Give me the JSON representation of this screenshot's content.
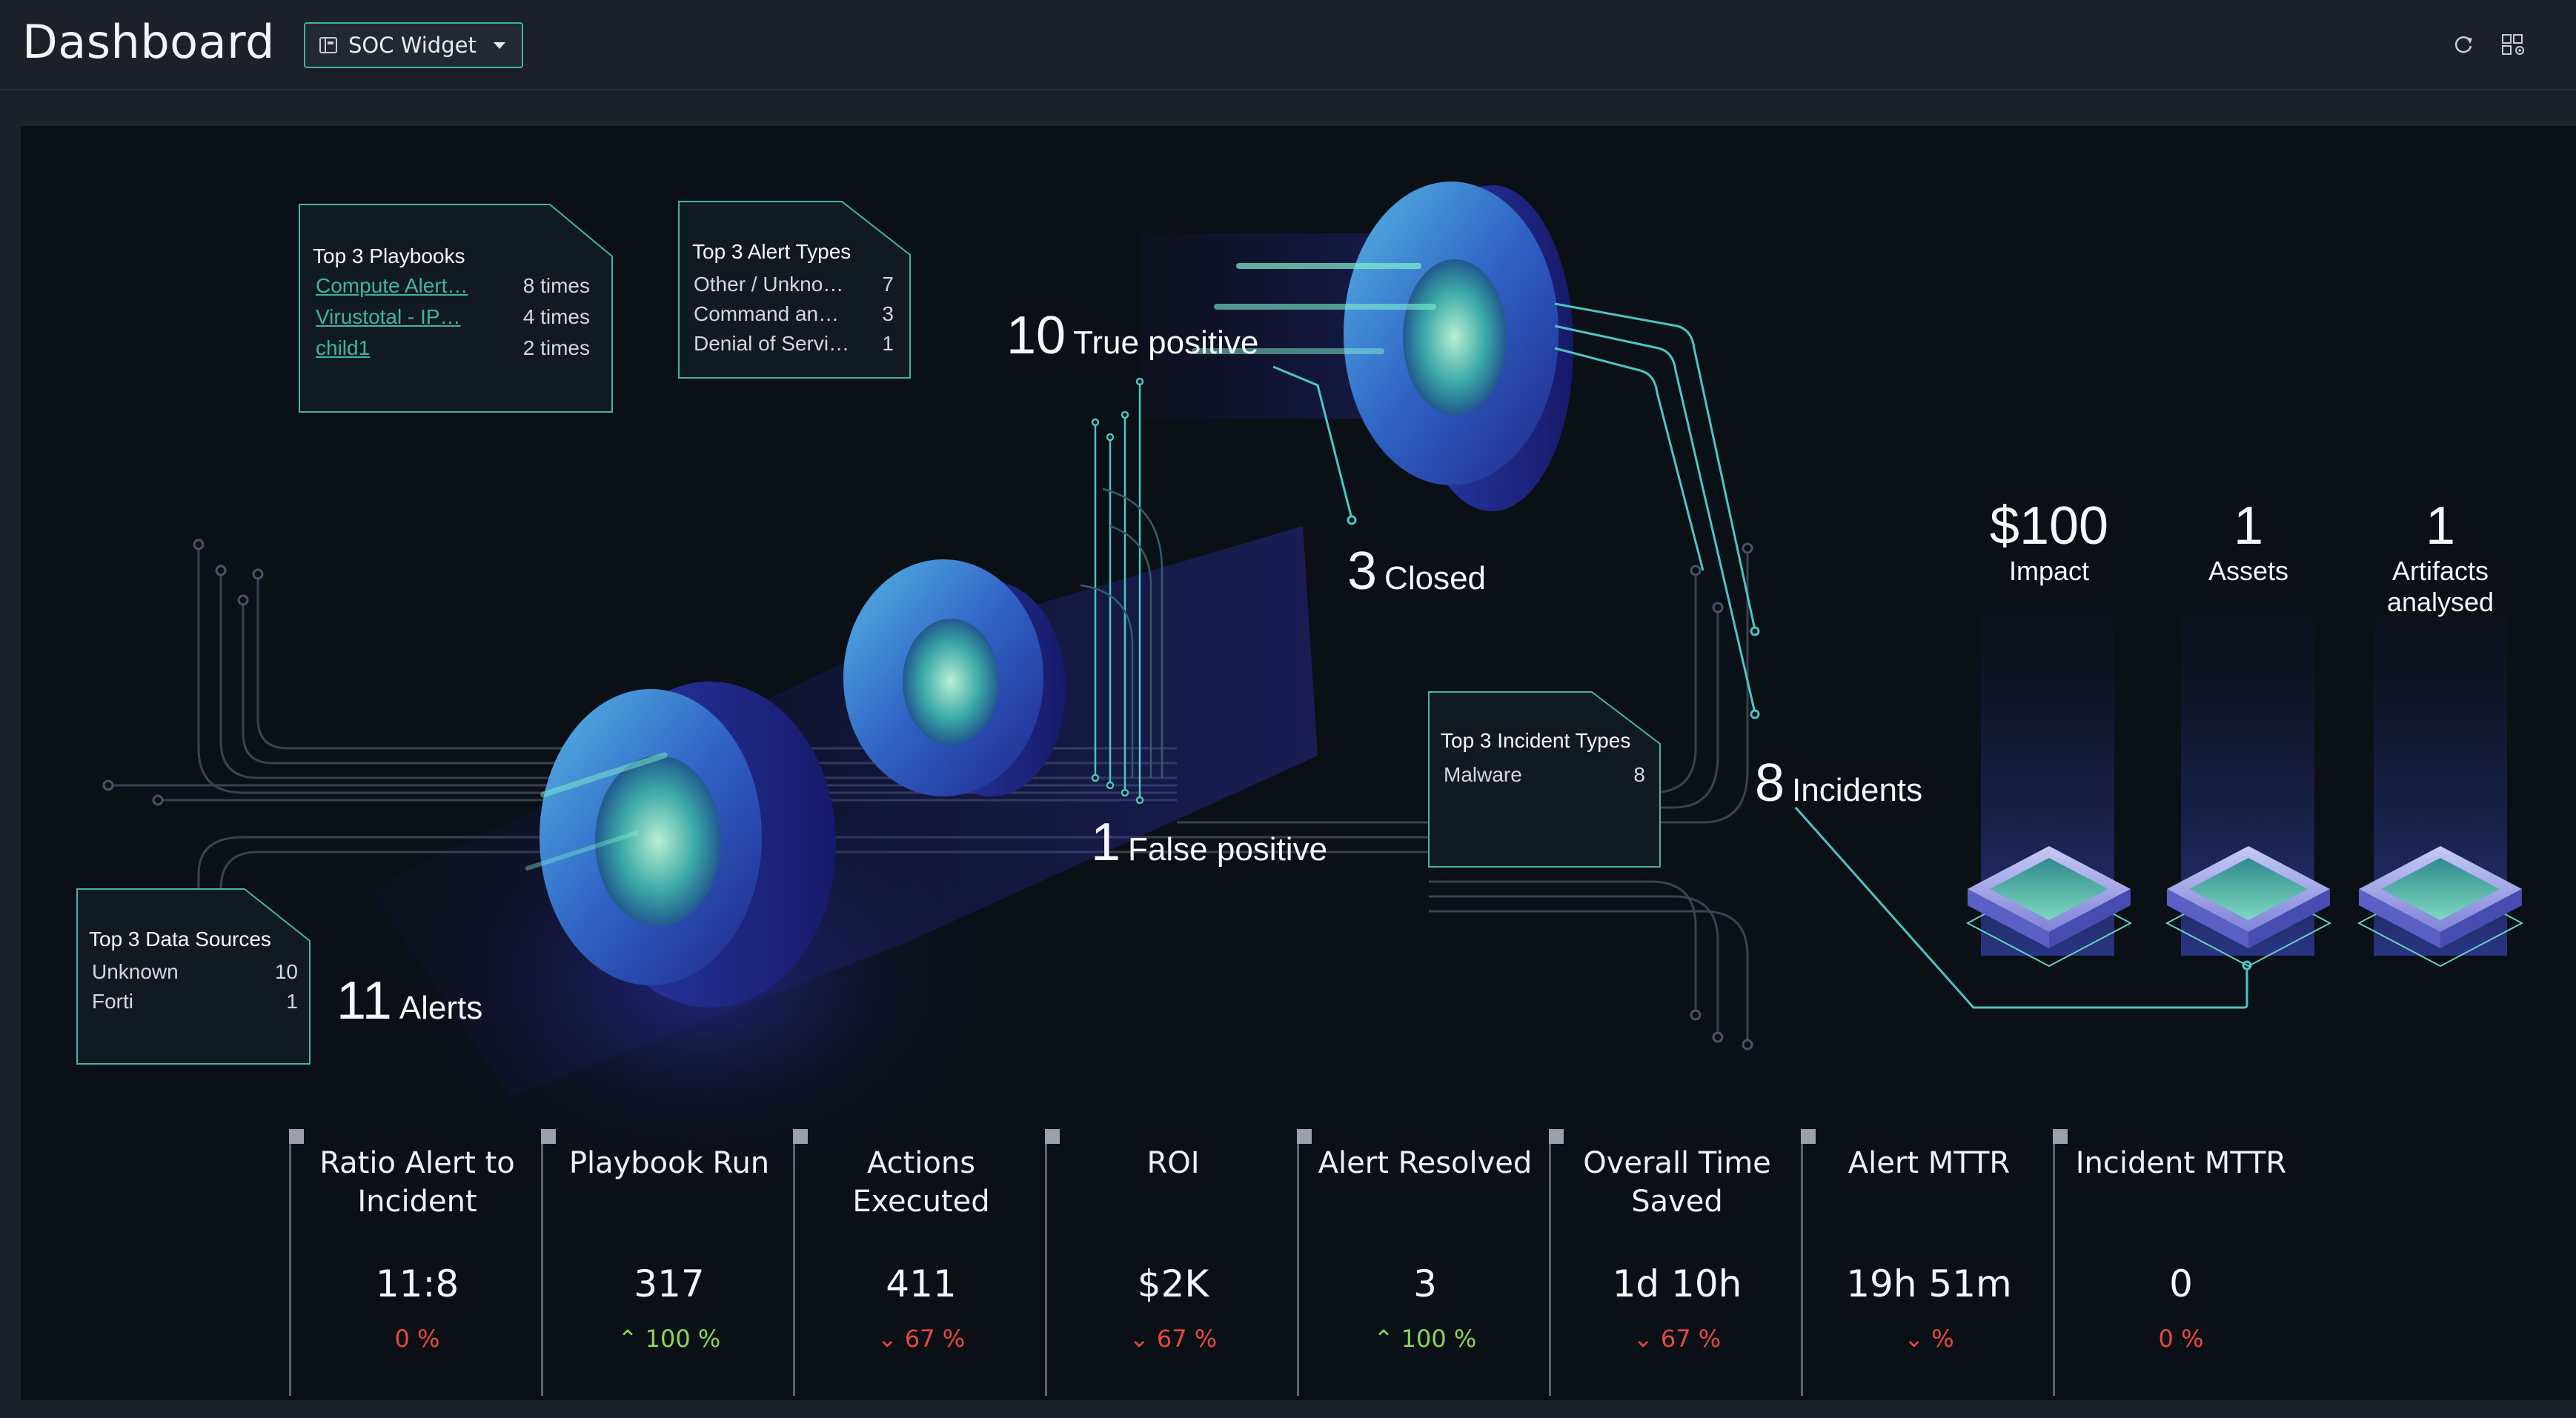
{
  "header": {
    "title": "Dashboard",
    "widget_selector": "SOC Widget",
    "refresh_icon": "refresh-icon",
    "layout_icon": "dashboard-settings-icon"
  },
  "playbooks": {
    "title": "Top 3 Playbooks",
    "rows": [
      {
        "name": "Compute Alert…",
        "value": "8 times"
      },
      {
        "name": "Virustotal - IP…",
        "value": "4 times"
      },
      {
        "name": "child1",
        "value": "2 times"
      }
    ]
  },
  "alert_types": {
    "title": "Top 3 Alert Types",
    "rows": [
      {
        "name": "Other / Unkno…",
        "value": "7"
      },
      {
        "name": "Command an…",
        "value": "3"
      },
      {
        "name": "Denial of Servi…",
        "value": "1"
      }
    ]
  },
  "data_sources": {
    "title": "Top 3 Data Sources",
    "rows": [
      {
        "name": "Unknown",
        "value": "10"
      },
      {
        "name": "Forti",
        "value": "1"
      }
    ]
  },
  "incident_types": {
    "title": "Top 3 Incident Types",
    "rows": [
      {
        "name": "Malware",
        "value": "8"
      }
    ]
  },
  "flow": {
    "alerts": {
      "value": "11",
      "label": "Alerts"
    },
    "true_positive": {
      "value": "10",
      "label": "True positive"
    },
    "false_positive": {
      "value": "1",
      "label": "False positive"
    },
    "closed": {
      "value": "3",
      "label": "Closed"
    },
    "incidents": {
      "value": "8",
      "label": "Incidents"
    }
  },
  "impact": [
    {
      "value": "$100",
      "label": "Impact"
    },
    {
      "value": "1",
      "label": "Assets"
    },
    {
      "value": "1",
      "label": "Artifacts analysed"
    }
  ],
  "metrics": [
    {
      "name": "Ratio Alert to Incident",
      "value": "11:8",
      "change": "0 %",
      "trend": "none"
    },
    {
      "name": "Playbook Run",
      "value": "317",
      "change": "100 %",
      "trend": "up"
    },
    {
      "name": "Actions Executed",
      "value": "411",
      "change": "67 %",
      "trend": "down"
    },
    {
      "name": "ROI",
      "value": "$2K",
      "change": "67 %",
      "trend": "down"
    },
    {
      "name": "Alert Resolved",
      "value": "3",
      "change": "100 %",
      "trend": "up"
    },
    {
      "name": "Overall Time Saved",
      "value": "1d 10h",
      "change": "67 %",
      "trend": "down"
    },
    {
      "name": "Alert MTTR",
      "value": "19h 51m",
      "change": "%",
      "trend": "down"
    },
    {
      "name": "Incident MTTR",
      "value": "0",
      "change": "0 %",
      "trend": "none"
    }
  ],
  "colors": {
    "accent": "#3fb5a5",
    "up": "#8bd65a",
    "down": "#e8483f",
    "stage_bg": "#0b0f16"
  }
}
